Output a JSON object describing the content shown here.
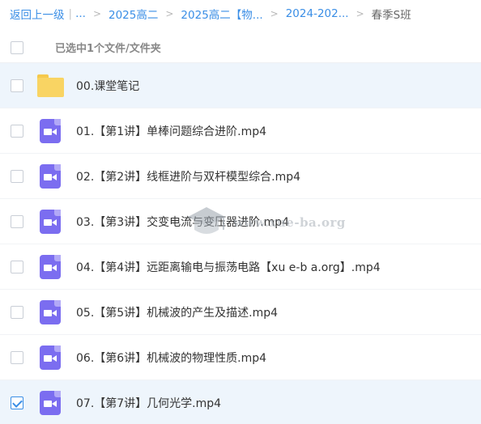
{
  "breadcrumb": {
    "back": "返回上一级",
    "pipe": "|",
    "ellipsis": "...",
    "items": [
      "2025高二",
      "2025高二【物...",
      "2024-202..."
    ],
    "separator": ">",
    "current": "春季S班"
  },
  "selection": {
    "label": "已选中1个文件/文件夹"
  },
  "files": [
    {
      "name": "00.课堂笔记",
      "type": "folder",
      "icon": "folder-icon",
      "checked": false
    },
    {
      "name": "01.【第1讲】单棒问题综合进阶.mp4",
      "type": "video",
      "icon": "video-file-icon",
      "checked": false
    },
    {
      "name": "02.【第2讲】线框进阶与双杆模型综合.mp4",
      "type": "video",
      "icon": "video-file-icon",
      "checked": false
    },
    {
      "name": "03.【第3讲】交变电流与变压器进阶.mp4",
      "type": "video",
      "icon": "video-file-icon",
      "checked": false
    },
    {
      "name": "04.【第4讲】远距离输电与振荡电路【xu e-b a.org】.mp4",
      "type": "video",
      "icon": "video-file-icon",
      "checked": false
    },
    {
      "name": "05.【第5讲】机械波的产生及描述.mp4",
      "type": "video",
      "icon": "video-file-icon",
      "checked": false
    },
    {
      "name": "06.【第6讲】机械波的物理性质.mp4",
      "type": "video",
      "icon": "video-file-icon",
      "checked": false
    },
    {
      "name": "07.【第7讲】几何光学.mp4",
      "type": "video",
      "icon": "video-file-icon",
      "checked": true
    }
  ],
  "watermark": {
    "text": "www.xue-ba.org"
  },
  "colors": {
    "accent": "#3a8ee6",
    "folder": "#f9d463",
    "video": "#7b6df0",
    "highlight": "#eef5fc"
  }
}
